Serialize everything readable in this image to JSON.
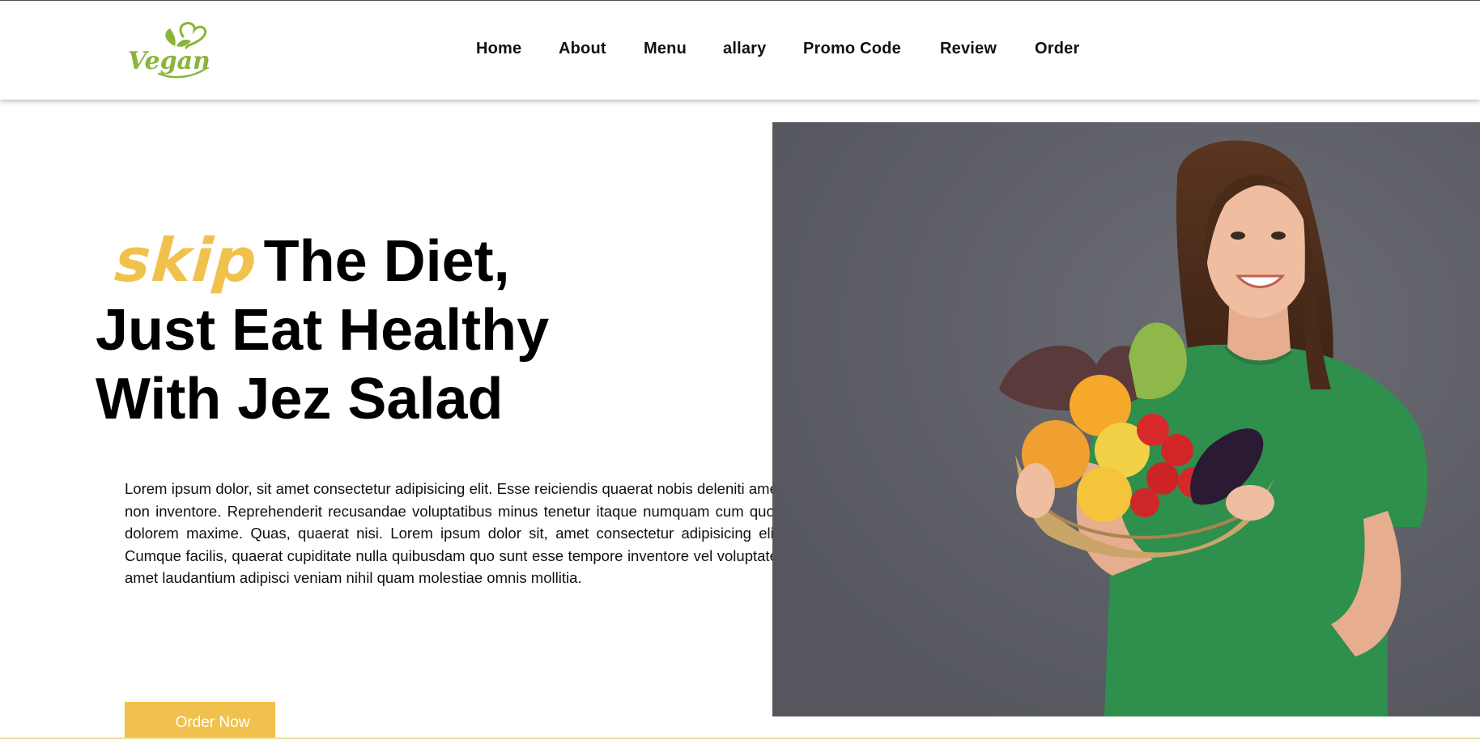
{
  "brand": {
    "logo_text": "Vegan",
    "accent": "#8ab43a"
  },
  "nav": {
    "items": [
      {
        "label": "Home"
      },
      {
        "label": "About"
      },
      {
        "label": "Menu"
      },
      {
        "label": "allary"
      },
      {
        "label": "Promo Code"
      },
      {
        "label": "Review"
      },
      {
        "label": "Order"
      }
    ]
  },
  "hero": {
    "highlight_word": "skip",
    "highlight_color": "#f0c24d",
    "title_line1_rest": "The Diet,",
    "title_line2": "Just Eat Healthy",
    "title_line3": "With Jez Salad",
    "description": "Lorem ipsum dolor, sit amet consectetur adipisicing elit. Esse reiciendis quaerat nobis deleniti amet non inventore. Reprehenderit recusandae voluptatibus minus tenetur itaque numquam cum quos dolorem maxime. Quas, quaerat nisi. Lorem ipsum dolor sit, amet consectetur adipisicing elit. Cumque facilis, quaerat cupiditate nulla quibusdam quo sunt esse tempore inventore vel voluptate, amet laudantium adipisci veniam nihil quam molestiae omnis mollitia.",
    "cta_label": "Order Now",
    "cta_color": "#f0c24d",
    "image": {
      "subject": "smiling woman in green t-shirt holding a basket of vegetables",
      "background": "#5d5e66"
    }
  }
}
